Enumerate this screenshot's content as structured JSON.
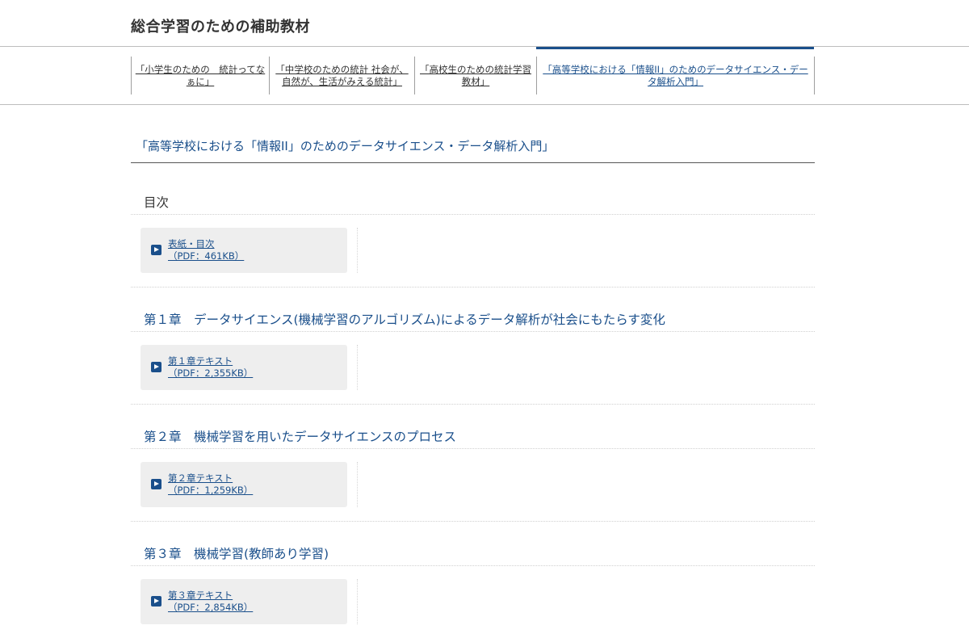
{
  "header": {
    "site_title": "総合学習のための補助教材"
  },
  "nav": {
    "items": [
      {
        "label": "「小学生のための　統計ってなぁに」"
      },
      {
        "label": "「中学校のための統計 社会が、自然が、生活がみえる統計」"
      },
      {
        "label": "「高校生のための統計学習教材」"
      },
      {
        "label": "「高等学校における「情報II」のためのデータサイエンス・データ解析入門」"
      }
    ],
    "active_index": 3
  },
  "page_heading": "「高等学校における「情報II」のためのデータサイエンス・データ解析入門」",
  "sections": [
    {
      "title": "目次",
      "link": {
        "name": "表紙・目次",
        "size": "（PDF：461KB）"
      }
    },
    {
      "title": "第１章　データサイエンス(機械学習のアルゴリズム)によるデータ解析が社会にもたらす変化",
      "link": {
        "name": "第１章テキスト",
        "size": "（PDF：2,355KB）"
      }
    },
    {
      "title": "第２章　機械学習を用いたデータサイエンスのプロセス",
      "link": {
        "name": "第２章テキスト",
        "size": "（PDF：1,259KB）"
      }
    },
    {
      "title": "第３章　機械学習(教師あり学習)",
      "link": {
        "name": "第３章テキスト",
        "size": "（PDF：2,854KB）"
      }
    }
  ],
  "colors": {
    "accent": "#1a4f8b",
    "box_bg": "#eeeeee",
    "text": "#333333"
  }
}
